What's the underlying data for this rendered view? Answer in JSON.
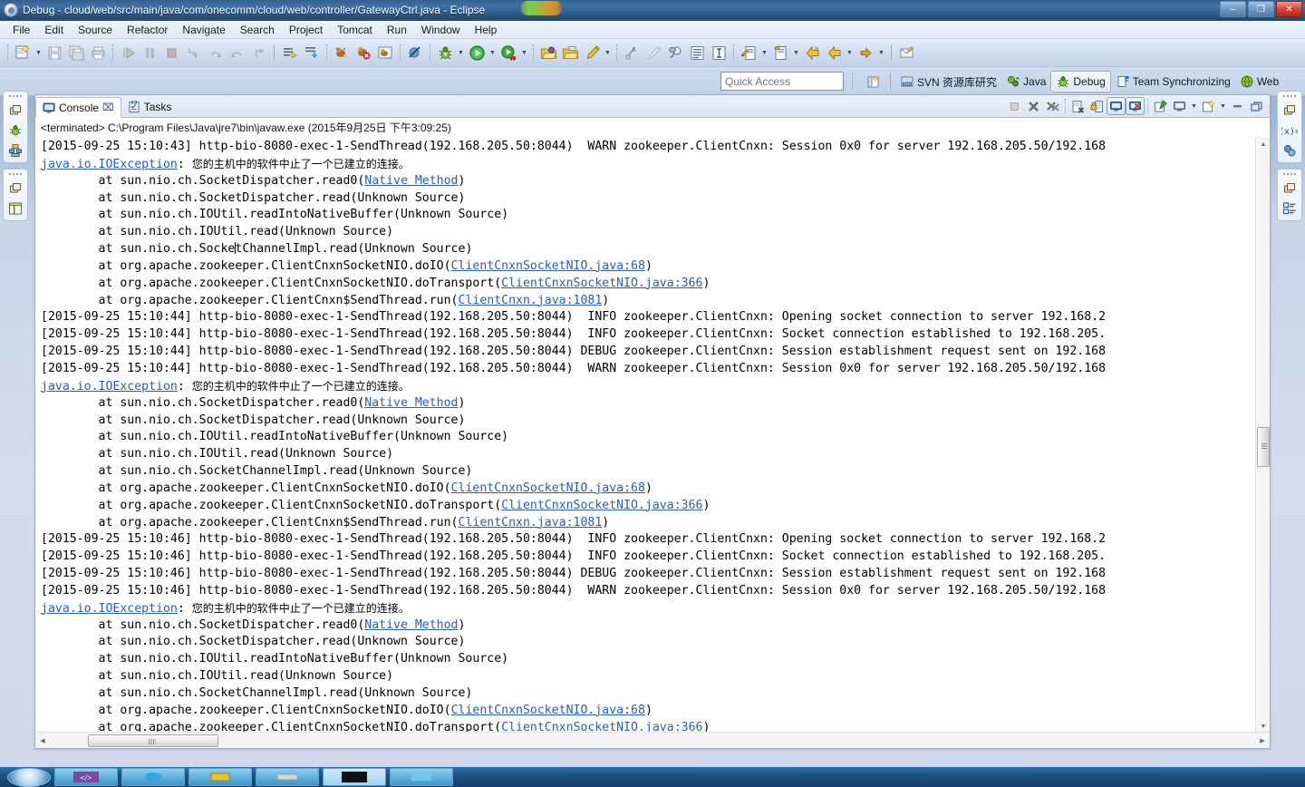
{
  "window": {
    "title": "Debug - cloud/web/src/main/java/com/onecomm/cloud/web/controller/GatewayCtrl.java - Eclipse",
    "app_icon": "eclipse-icon",
    "buttons": {
      "minimize": "–",
      "maximize": "❐",
      "close": "✕"
    }
  },
  "menubar": {
    "items": [
      {
        "label": "File"
      },
      {
        "label": "Edit"
      },
      {
        "label": "Source"
      },
      {
        "label": "Refactor"
      },
      {
        "label": "Navigate"
      },
      {
        "label": "Search"
      },
      {
        "label": "Project"
      },
      {
        "label": "Tomcat"
      },
      {
        "label": "Run"
      },
      {
        "label": "Window"
      },
      {
        "label": "Help"
      }
    ]
  },
  "toolbar": {
    "groups": [
      {
        "items": [
          {
            "icon": "new-wizard-icon",
            "enabled": true
          },
          {
            "icon": "dropdown-arrow-icon",
            "arrow": true
          },
          {
            "icon": "save-icon",
            "enabled": false
          },
          {
            "icon": "save-all-icon",
            "enabled": false
          },
          {
            "icon": "print-icon",
            "enabled": false
          }
        ]
      },
      {
        "items": [
          {
            "icon": "resume-icon",
            "enabled": false
          },
          {
            "icon": "suspend-icon",
            "enabled": false
          },
          {
            "icon": "terminate-icon",
            "enabled": false
          },
          {
            "icon": "step-into-icon",
            "enabled": false
          },
          {
            "icon": "step-over-icon",
            "enabled": false
          },
          {
            "icon": "step-return-icon",
            "enabled": false
          },
          {
            "icon": "drop-to-frame-icon",
            "enabled": false
          }
        ]
      },
      {
        "items": [
          {
            "icon": "next-annotation-icon",
            "enabled": true
          },
          {
            "icon": "previous-annotation-icon",
            "enabled": true
          }
        ]
      },
      {
        "items": [
          {
            "icon": "ant-build-icon",
            "enabled": true
          },
          {
            "icon": "ant-build-error-icon",
            "enabled": true
          },
          {
            "icon": "ant-view-icon",
            "enabled": true
          }
        ]
      },
      {
        "items": [
          {
            "icon": "skip-breakpoints-icon",
            "enabled": true
          }
        ]
      },
      {
        "items": [
          {
            "icon": "debug-bug-icon",
            "enabled": true
          },
          {
            "icon": "dropdown-arrow-icon",
            "arrow": true
          },
          {
            "icon": "run-play-icon",
            "enabled": true
          },
          {
            "icon": "dropdown-arrow-icon",
            "arrow": true
          },
          {
            "icon": "run-external-tools-icon",
            "enabled": true
          },
          {
            "icon": "dropdown-arrow-icon",
            "arrow": true
          }
        ]
      },
      {
        "items": [
          {
            "icon": "open-package-icon",
            "enabled": true
          },
          {
            "icon": "open-type-icon",
            "enabled": true
          },
          {
            "icon": "new-java-class-icon",
            "enabled": true
          },
          {
            "icon": "dropdown-arrow-icon",
            "arrow": true
          }
        ]
      },
      {
        "items": [
          {
            "icon": "toggle-mark-occurrences-icon",
            "enabled": true
          },
          {
            "icon": "pencil-icon",
            "enabled": false
          },
          {
            "icon": "search-link-icon",
            "enabled": true
          },
          {
            "icon": "show-whitespace-icon",
            "enabled": true
          },
          {
            "icon": "block-selection-icon",
            "enabled": true
          }
        ]
      },
      {
        "items": [
          {
            "icon": "last-edit-location-icon",
            "enabled": true
          },
          {
            "icon": "dropdown-arrow-icon",
            "arrow": true
          },
          {
            "icon": "next-edit-icon",
            "enabled": true
          },
          {
            "icon": "dropdown-arrow-icon",
            "arrow": true
          },
          {
            "icon": "back-history-yellow-icon",
            "enabled": true
          },
          {
            "icon": "back-arrow-icon",
            "enabled": true
          },
          {
            "icon": "dropdown-arrow-icon",
            "arrow": true
          },
          {
            "icon": "forward-arrow-icon",
            "enabled": true
          },
          {
            "icon": "dropdown-arrow-icon",
            "arrow": true
          }
        ]
      },
      {
        "items": [
          {
            "icon": "open-task-icon",
            "enabled": true
          }
        ]
      }
    ]
  },
  "quick_access": {
    "placeholder": "Quick Access",
    "value": ""
  },
  "perspectives": {
    "open_perspective_icon": "open-perspective-icon",
    "items": [
      {
        "label": "SVN 资源库研究",
        "icon": "svn-repository-icon",
        "active": false
      },
      {
        "label": "Java",
        "icon": "java-perspective-icon",
        "active": false
      },
      {
        "label": "Debug",
        "icon": "debug-perspective-icon",
        "active": true
      },
      {
        "label": "Team Synchronizing",
        "icon": "team-sync-icon",
        "active": false
      },
      {
        "label": "Web",
        "icon": "web-perspective-icon",
        "active": false
      }
    ]
  },
  "fast_view_left": {
    "stacks": [
      {
        "icons": [
          "restore-icon",
          "debug-view-icon",
          "servers-view-icon"
        ]
      },
      {
        "icons": [
          "restore-icon",
          "outline-view-icon"
        ]
      }
    ]
  },
  "fast_view_right": {
    "stacks": [
      {
        "icons": [
          "restore-icon",
          "variables-view-icon",
          "breakpoints-view-icon"
        ]
      },
      {
        "icons": [
          "restore-icon",
          "outline-tree-icon"
        ]
      }
    ]
  },
  "console_view": {
    "tabs": [
      {
        "label": "Console",
        "icon": "console-icon",
        "active": true,
        "closeable": true,
        "close_glyph": "⌧"
      },
      {
        "label": "Tasks",
        "icon": "tasks-icon",
        "active": false,
        "closeable": false
      }
    ],
    "toolbar": [
      {
        "icon": "terminate-icon",
        "enabled": false,
        "toggled": false
      },
      {
        "icon": "remove-launch-icon",
        "enabled": true,
        "toggled": false
      },
      {
        "icon": "remove-all-launches-icon",
        "enabled": true,
        "toggled": false
      },
      {
        "icon": "clear-console-icon",
        "enabled": true,
        "toggled": false
      },
      {
        "icon": "scroll-lock-icon",
        "enabled": true,
        "toggled": false
      },
      {
        "icon": "show-console-on-output-icon",
        "enabled": true,
        "toggled": true
      },
      {
        "icon": "show-console-on-error-icon",
        "enabled": true,
        "toggled": true
      },
      {
        "icon": "pin-console-icon",
        "enabled": true,
        "toggled": false
      },
      {
        "icon": "display-selected-console-icon",
        "enabled": true,
        "toggled": false
      },
      {
        "icon": "dropdown-arrow-icon",
        "arrow": true
      },
      {
        "icon": "open-console-icon",
        "enabled": true,
        "toggled": false
      },
      {
        "icon": "dropdown-arrow-icon",
        "arrow": true
      },
      {
        "icon": "minimize-view-icon",
        "enabled": true,
        "toggled": false
      },
      {
        "icon": "maximize-view-icon",
        "enabled": true,
        "toggled": false
      }
    ],
    "header": "<terminated> C:\\Program Files\\Java\\jre7\\bin\\javaw.exe (2015年9月25日 下午3:09:25)",
    "lines": [
      {
        "segments": [
          {
            "t": "[2015-09-25 15:10:43] http-bio-8080-exec-1-SendThread(192.168.205.50:8044)  WARN zookeeper.ClientCnxn: Session 0x0 for server 192.168.205.50/192.168",
            "k": "p"
          }
        ]
      },
      {
        "segments": [
          {
            "t": "java.io.IOException",
            "k": "link"
          },
          {
            "t": ": ",
            "k": "p"
          },
          {
            "t": "您的主机中的软件中止了一个已建立的连接。",
            "k": "cn"
          }
        ]
      },
      {
        "segments": [
          {
            "t": "\tat sun.nio.ch.SocketDispatcher.read0(",
            "k": "p"
          },
          {
            "t": "Native Method",
            "k": "link"
          },
          {
            "t": ")",
            "k": "p"
          }
        ]
      },
      {
        "segments": [
          {
            "t": "\tat sun.nio.ch.SocketDispatcher.read(Unknown Source)",
            "k": "p"
          }
        ]
      },
      {
        "segments": [
          {
            "t": "\tat sun.nio.ch.IOUtil.readIntoNativeBuffer(Unknown Source)",
            "k": "p"
          }
        ]
      },
      {
        "segments": [
          {
            "t": "\tat sun.nio.ch.IOUtil.read(Unknown Source)",
            "k": "p"
          }
        ]
      },
      {
        "segments": [
          {
            "t": "\tat sun.nio.ch.Socke",
            "k": "p"
          },
          {
            "t": "",
            "k": "caret"
          },
          {
            "t": "tChannelImpl.read(Unknown Source)",
            "k": "p"
          }
        ]
      },
      {
        "segments": [
          {
            "t": "\tat org.apache.zookeeper.ClientCnxnSocketNIO.doIO(",
            "k": "p"
          },
          {
            "t": "ClientCnxnSocketNIO.java:68",
            "k": "link"
          },
          {
            "t": ")",
            "k": "p"
          }
        ]
      },
      {
        "segments": [
          {
            "t": "\tat org.apache.zookeeper.ClientCnxnSocketNIO.doTransport(",
            "k": "p"
          },
          {
            "t": "ClientCnxnSocketNIO.java:366",
            "k": "link"
          },
          {
            "t": ")",
            "k": "p"
          }
        ]
      },
      {
        "segments": [
          {
            "t": "\tat org.apache.zookeeper.ClientCnxn$SendThread.run(",
            "k": "p"
          },
          {
            "t": "ClientCnxn.java:1081",
            "k": "link"
          },
          {
            "t": ")",
            "k": "p"
          }
        ]
      },
      {
        "segments": [
          {
            "t": "[2015-09-25 15:10:44] http-bio-8080-exec-1-SendThread(192.168.205.50:8044)  INFO zookeeper.ClientCnxn: Opening socket connection to server 192.168.2",
            "k": "p"
          }
        ]
      },
      {
        "segments": [
          {
            "t": "[2015-09-25 15:10:44] http-bio-8080-exec-1-SendThread(192.168.205.50:8044)  INFO zookeeper.ClientCnxn: Socket connection established to 192.168.205.",
            "k": "p"
          }
        ]
      },
      {
        "segments": [
          {
            "t": "[2015-09-25 15:10:44] http-bio-8080-exec-1-SendThread(192.168.205.50:8044) DEBUG zookeeper.ClientCnxn: Session establishment request sent on 192.168",
            "k": "p"
          }
        ]
      },
      {
        "segments": [
          {
            "t": "[2015-09-25 15:10:44] http-bio-8080-exec-1-SendThread(192.168.205.50:8044)  WARN zookeeper.ClientCnxn: Session 0x0 for server 192.168.205.50/192.168",
            "k": "p"
          }
        ]
      },
      {
        "segments": [
          {
            "t": "java.io.IOException",
            "k": "link"
          },
          {
            "t": ": ",
            "k": "p"
          },
          {
            "t": "您的主机中的软件中止了一个已建立的连接。",
            "k": "cn"
          }
        ]
      },
      {
        "segments": [
          {
            "t": "\tat sun.nio.ch.SocketDispatcher.read0(",
            "k": "p"
          },
          {
            "t": "Native Method",
            "k": "link"
          },
          {
            "t": ")",
            "k": "p"
          }
        ]
      },
      {
        "segments": [
          {
            "t": "\tat sun.nio.ch.SocketDispatcher.read(Unknown Source)",
            "k": "p"
          }
        ]
      },
      {
        "segments": [
          {
            "t": "\tat sun.nio.ch.IOUtil.readIntoNativeBuffer(Unknown Source)",
            "k": "p"
          }
        ]
      },
      {
        "segments": [
          {
            "t": "\tat sun.nio.ch.IOUtil.read(Unknown Source)",
            "k": "p"
          }
        ]
      },
      {
        "segments": [
          {
            "t": "\tat sun.nio.ch.SocketChannelImpl.read(Unknown Source)",
            "k": "p"
          }
        ]
      },
      {
        "segments": [
          {
            "t": "\tat org.apache.zookeeper.ClientCnxnSocketNIO.doIO(",
            "k": "p"
          },
          {
            "t": "ClientCnxnSocketNIO.java:68",
            "k": "link"
          },
          {
            "t": ")",
            "k": "p"
          }
        ]
      },
      {
        "segments": [
          {
            "t": "\tat org.apache.zookeeper.ClientCnxnSocketNIO.doTransport(",
            "k": "p"
          },
          {
            "t": "ClientCnxnSocketNIO.java:366",
            "k": "link"
          },
          {
            "t": ")",
            "k": "p"
          }
        ]
      },
      {
        "segments": [
          {
            "t": "\tat org.apache.zookeeper.ClientCnxn$SendThread.run(",
            "k": "p"
          },
          {
            "t": "ClientCnxn.java:1081",
            "k": "link"
          },
          {
            "t": ")",
            "k": "p"
          }
        ]
      },
      {
        "segments": [
          {
            "t": "[2015-09-25 15:10:46] http-bio-8080-exec-1-SendThread(192.168.205.50:8044)  INFO zookeeper.ClientCnxn: Opening socket connection to server 192.168.2",
            "k": "p"
          }
        ]
      },
      {
        "segments": [
          {
            "t": "[2015-09-25 15:10:46] http-bio-8080-exec-1-SendThread(192.168.205.50:8044)  INFO zookeeper.ClientCnxn: Socket connection established to 192.168.205.",
            "k": "p"
          }
        ]
      },
      {
        "segments": [
          {
            "t": "[2015-09-25 15:10:46] http-bio-8080-exec-1-SendThread(192.168.205.50:8044) DEBUG zookeeper.ClientCnxn: Session establishment request sent on 192.168",
            "k": "p"
          }
        ]
      },
      {
        "segments": [
          {
            "t": "[2015-09-25 15:10:46] http-bio-8080-exec-1-SendThread(192.168.205.50:8044)  WARN zookeeper.ClientCnxn: Session 0x0 for server 192.168.205.50/192.168",
            "k": "p"
          }
        ]
      },
      {
        "segments": [
          {
            "t": "java.io.IOException",
            "k": "link"
          },
          {
            "t": ": ",
            "k": "p"
          },
          {
            "t": "您的主机中的软件中止了一个已建立的连接。",
            "k": "cn"
          }
        ]
      },
      {
        "segments": [
          {
            "t": "\tat sun.nio.ch.SocketDispatcher.read0(",
            "k": "p"
          },
          {
            "t": "Native Method",
            "k": "link"
          },
          {
            "t": ")",
            "k": "p"
          }
        ]
      },
      {
        "segments": [
          {
            "t": "\tat sun.nio.ch.SocketDispatcher.read(Unknown Source)",
            "k": "p"
          }
        ]
      },
      {
        "segments": [
          {
            "t": "\tat sun.nio.ch.IOUtil.readIntoNativeBuffer(Unknown Source)",
            "k": "p"
          }
        ]
      },
      {
        "segments": [
          {
            "t": "\tat sun.nio.ch.IOUtil.read(Unknown Source)",
            "k": "p"
          }
        ]
      },
      {
        "segments": [
          {
            "t": "\tat sun.nio.ch.SocketChannelImpl.read(Unknown Source)",
            "k": "p"
          }
        ]
      },
      {
        "segments": [
          {
            "t": "\tat org.apache.zookeeper.ClientCnxnSocketNIO.doIO(",
            "k": "p"
          },
          {
            "t": "ClientCnxnSocketNIO.java:68",
            "k": "link"
          },
          {
            "t": ")",
            "k": "p"
          }
        ]
      },
      {
        "segments": [
          {
            "t": "\tat org.apache.zookeeper.ClientCnxnSocketNIO.doTransport(",
            "k": "p"
          },
          {
            "t": "ClientCnxnSocketNIO.java:366",
            "k": "link"
          },
          {
            "t": ")",
            "k": "p"
          }
        ]
      }
    ],
    "scrollbars": {
      "vertical": {
        "up_glyph": "▲",
        "down_glyph": "▼"
      },
      "horizontal": {
        "left_glyph": "◀",
        "right_glyph": "▶"
      }
    }
  },
  "taskbar": {
    "start_label": "start-orb",
    "tasks": [
      {
        "name": "taskbar-item-1"
      },
      {
        "name": "taskbar-item-2"
      },
      {
        "name": "taskbar-item-3"
      },
      {
        "name": "taskbar-item-4"
      },
      {
        "name": "taskbar-item-5"
      },
      {
        "name": "taskbar-item-6"
      }
    ]
  },
  "colors": {
    "link": "#2a5db0",
    "title_bar": "#2e5c8c",
    "console_bg": "#ffffff",
    "chrome": "#c8d4e8"
  }
}
